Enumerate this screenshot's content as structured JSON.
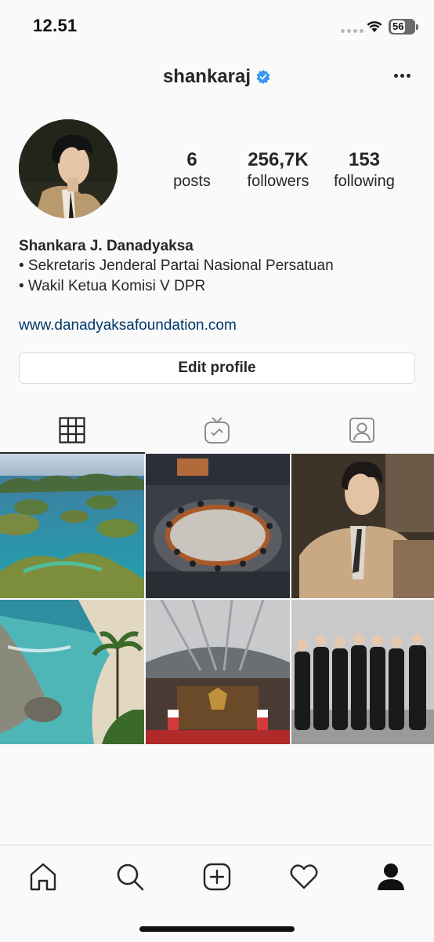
{
  "status_bar": {
    "time": "12.51",
    "battery": "56"
  },
  "header": {
    "username": "shankaraj",
    "verified_icon": "verified-badge-icon",
    "more_icon": "more-options-icon"
  },
  "profile": {
    "stats": [
      {
        "value": "6",
        "label": "posts"
      },
      {
        "value": "256,7K",
        "label": "followers"
      },
      {
        "value": "153",
        "label": "following"
      }
    ],
    "name": "Shankara J. Danadyaksa",
    "bio_lines": [
      "• Sekretaris Jenderal Partai Nasional Persatuan",
      "• Wakil Ketua Komisi V DPR"
    ],
    "link": "www.danadyaksafoundation.com",
    "edit_button": "Edit profile"
  },
  "tabs": [
    {
      "icon": "grid-icon",
      "active": true
    },
    {
      "icon": "igtv-icon",
      "active": false
    },
    {
      "icon": "tagged-icon",
      "active": false
    }
  ],
  "grid_posts": [
    {
      "subject": "tropical islands aerial"
    },
    {
      "subject": "council chamber meeting"
    },
    {
      "subject": "man in beige suit"
    },
    {
      "subject": "coastal cliffs beach"
    },
    {
      "subject": "parliament hall"
    },
    {
      "subject": "group in black suits"
    }
  ],
  "bottom_nav": [
    {
      "icon": "home-icon"
    },
    {
      "icon": "search-icon"
    },
    {
      "icon": "new-post-icon"
    },
    {
      "icon": "activity-heart-icon"
    },
    {
      "icon": "profile-icon"
    }
  ],
  "colors": {
    "link": "#00376b",
    "verified": "#3897f0",
    "text": "#262626",
    "border": "#dbdbdb"
  }
}
